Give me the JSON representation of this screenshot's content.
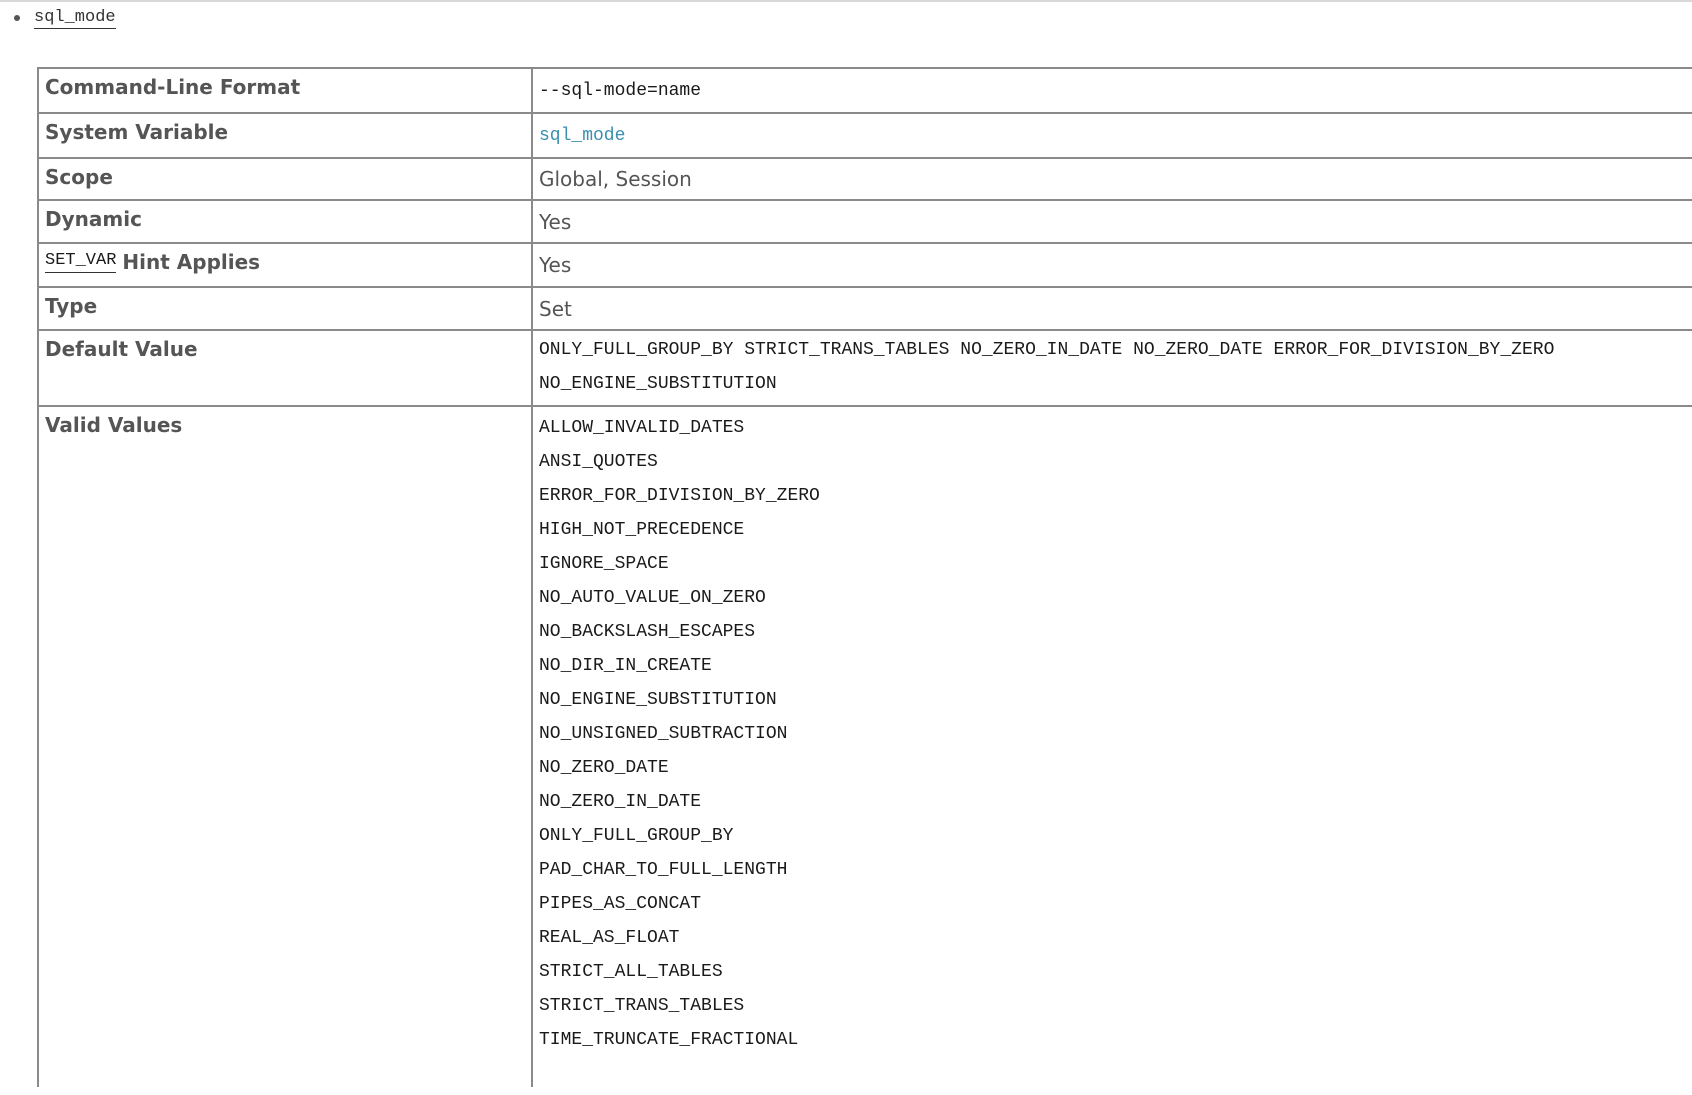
{
  "variable": {
    "name": "sql_mode"
  },
  "properties": {
    "command_line_format": {
      "label": "Command-Line Format",
      "value": "--sql-mode=name"
    },
    "system_variable": {
      "label": "System Variable",
      "value": "sql_mode"
    },
    "scope": {
      "label": "Scope",
      "value": "Global, Session"
    },
    "dynamic": {
      "label": "Dynamic",
      "value": "Yes"
    },
    "set_var": {
      "label_code": "SET_VAR",
      "label_text": "Hint Applies",
      "value": "Yes"
    },
    "type": {
      "label": "Type",
      "value": "Set"
    },
    "default_value": {
      "label": "Default Value",
      "lines": [
        "ONLY_FULL_GROUP_BY STRICT_TRANS_TABLES NO_ZERO_IN_DATE NO_ZERO_DATE ERROR_FOR_DIVISION_BY_ZERO",
        "NO_ENGINE_SUBSTITUTION"
      ]
    },
    "valid_values": {
      "label": "Valid Values",
      "items": [
        "ALLOW_INVALID_DATES",
        "ANSI_QUOTES",
        "ERROR_FOR_DIVISION_BY_ZERO",
        "HIGH_NOT_PRECEDENCE",
        "IGNORE_SPACE",
        "NO_AUTO_VALUE_ON_ZERO",
        "NO_BACKSLASH_ESCAPES",
        "NO_DIR_IN_CREATE",
        "NO_ENGINE_SUBSTITUTION",
        "NO_UNSIGNED_SUBTRACTION",
        "NO_ZERO_DATE",
        "NO_ZERO_IN_DATE",
        "ONLY_FULL_GROUP_BY",
        "PAD_CHAR_TO_FULL_LENGTH",
        "PIPES_AS_CONCAT",
        "REAL_AS_FLOAT",
        "STRICT_ALL_TABLES",
        "STRICT_TRANS_TABLES",
        "TIME_TRUNCATE_FRACTIONAL"
      ]
    }
  },
  "colors": {
    "text": "#555555",
    "code": "#1a1a1a",
    "link": "#3a8fb0",
    "border": "#8a8a8a"
  }
}
